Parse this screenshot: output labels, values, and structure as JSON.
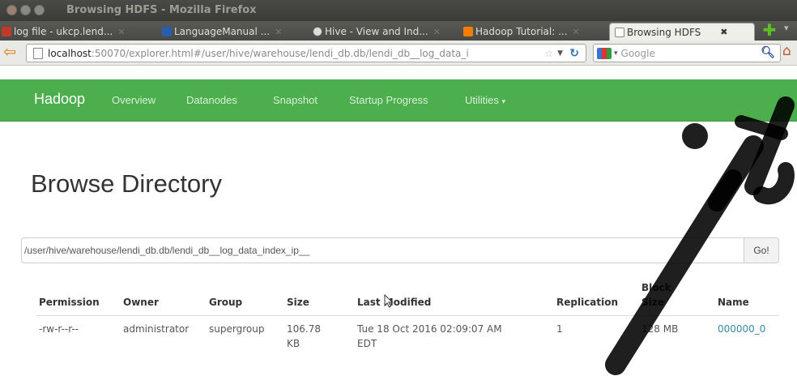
{
  "window": {
    "title": "Browsing HDFS - Mozilla Firefox"
  },
  "tabs": [
    {
      "label": "log file - ukcp.lend...",
      "icon": "mail-icon",
      "icon_color": "#c0392b"
    },
    {
      "label": "LanguageManual ...",
      "icon": "confluence-icon",
      "icon_color": "#2a5db0"
    },
    {
      "label": "Hive - View and Ind...",
      "icon": "globe-icon",
      "icon_color": "#666666"
    },
    {
      "label": "Hadoop Tutorial: ...",
      "icon": "blogger-icon",
      "icon_color": "#f57d00"
    },
    {
      "label": "Browsing HDFS",
      "icon": "page-icon",
      "icon_color": "#dddddd",
      "active": true
    }
  ],
  "urlbar": {
    "host": "localhost",
    "path": ":50070/explorer.html#/user/hive/warehouse/lendi_db.db/lendi_db__log_data_i"
  },
  "searchbar": {
    "placeholder": "Google"
  },
  "hadoop_nav": {
    "brand": "Hadoop",
    "links": [
      "Overview",
      "Datanodes",
      "Snapshot",
      "Startup Progress",
      "Utilities"
    ],
    "accent_color": "#4cae4c"
  },
  "page": {
    "title": "Browse Directory",
    "path_value": "/user/hive/warehouse/lendi_db.db/lendi_db__log_data_index_ip__",
    "go_label": "Go!"
  },
  "table": {
    "headers": {
      "permission": "Permission",
      "owner": "Owner",
      "group": "Group",
      "size": "Size",
      "last_modified": "Last Modified",
      "replication": "Replication",
      "block_size_1": "Block",
      "block_size_2": "Size",
      "name": "Name"
    },
    "rows": [
      {
        "permission": "-rw-r--r--",
        "owner": "administrator",
        "group": "supergroup",
        "size_1": "106.78",
        "size_2": "KB",
        "last_modified_1": "Tue 18 Oct 2016 02:09:07 AM",
        "last_modified_2": "EDT",
        "replication": "1",
        "block_size": "128 MB",
        "name": "000000_0"
      }
    ]
  }
}
